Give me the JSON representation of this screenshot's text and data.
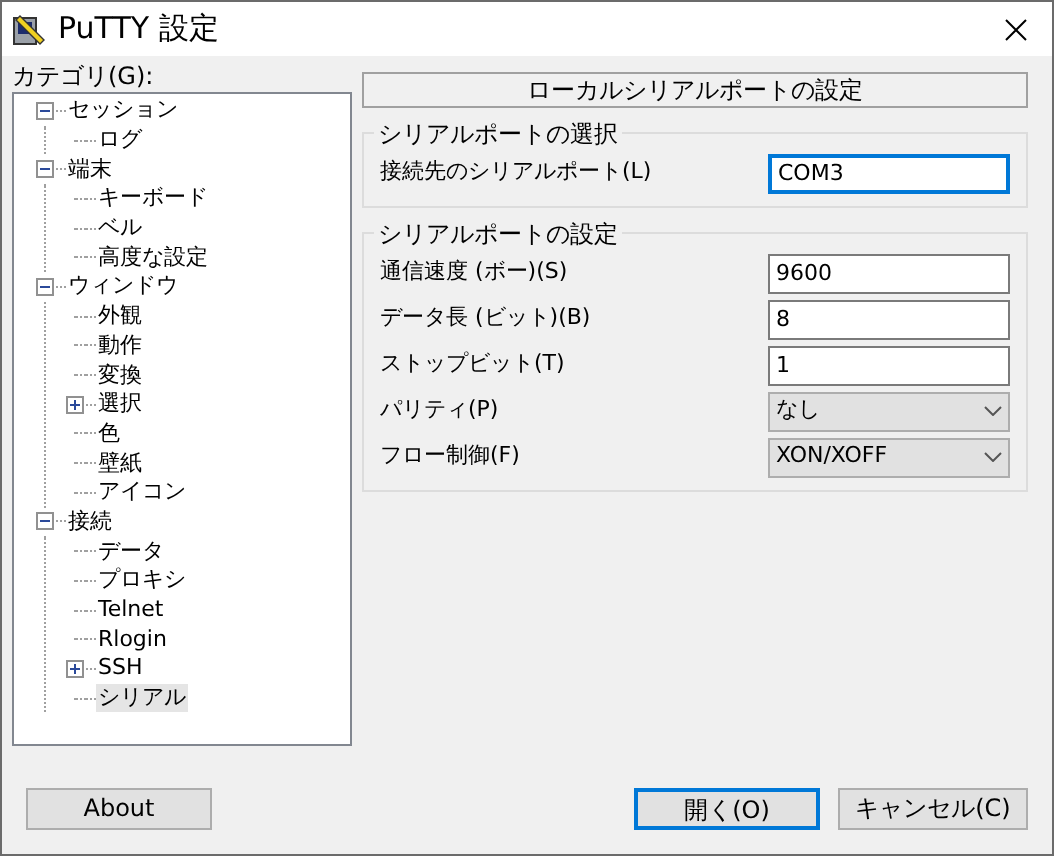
{
  "window": {
    "title": "PuTTY 設定"
  },
  "category_label": "カテゴリ(G):",
  "tree": [
    {
      "label": "セッション",
      "expanded": true,
      "selected": false,
      "children": [
        {
          "label": "ログ",
          "selected": false
        }
      ]
    },
    {
      "label": "端末",
      "expanded": true,
      "selected": false,
      "children": [
        {
          "label": "キーボード",
          "selected": false
        },
        {
          "label": "ベル",
          "selected": false
        },
        {
          "label": "高度な設定",
          "selected": false
        }
      ]
    },
    {
      "label": "ウィンドウ",
      "expanded": true,
      "selected": false,
      "children": [
        {
          "label": "外観",
          "selected": false
        },
        {
          "label": "動作",
          "selected": false
        },
        {
          "label": "変換",
          "selected": false
        },
        {
          "label": "選択",
          "expanded": false,
          "selected": false
        },
        {
          "label": "色",
          "selected": false
        },
        {
          "label": "壁紙",
          "selected": false
        },
        {
          "label": "アイコン",
          "selected": false
        }
      ]
    },
    {
      "label": "接続",
      "expanded": true,
      "selected": false,
      "children": [
        {
          "label": "データ",
          "selected": false
        },
        {
          "label": "プロキシ",
          "selected": false
        },
        {
          "label": "Telnet",
          "selected": false
        },
        {
          "label": "Rlogin",
          "selected": false
        },
        {
          "label": "SSH",
          "expanded": false,
          "selected": false
        },
        {
          "label": "シリアル",
          "selected": true
        }
      ]
    }
  ],
  "panel_header": "ローカルシリアルポートの設定",
  "groups": [
    {
      "title": "シリアルポートの選択",
      "fields": [
        {
          "label": "接続先のシリアルポート(L)",
          "kind": "text",
          "value": "COM3",
          "focused": true
        }
      ]
    },
    {
      "title": "シリアルポートの設定",
      "fields": [
        {
          "label": "通信速度 (ボー)(S)",
          "kind": "text",
          "value": "9600",
          "focused": false
        },
        {
          "label": "データ長 (ビット)(B)",
          "kind": "text",
          "value": "8",
          "focused": false
        },
        {
          "label": "ストップビット(T)",
          "kind": "text",
          "value": "1",
          "focused": false
        },
        {
          "label": "パリティ(P)",
          "kind": "select",
          "value": "なし"
        },
        {
          "label": "フロー制御(F)",
          "kind": "select",
          "value": "XON/XOFF"
        }
      ]
    }
  ],
  "buttons": {
    "about": "About",
    "open": "開く(O)",
    "cancel": "キャンセル(C)"
  }
}
